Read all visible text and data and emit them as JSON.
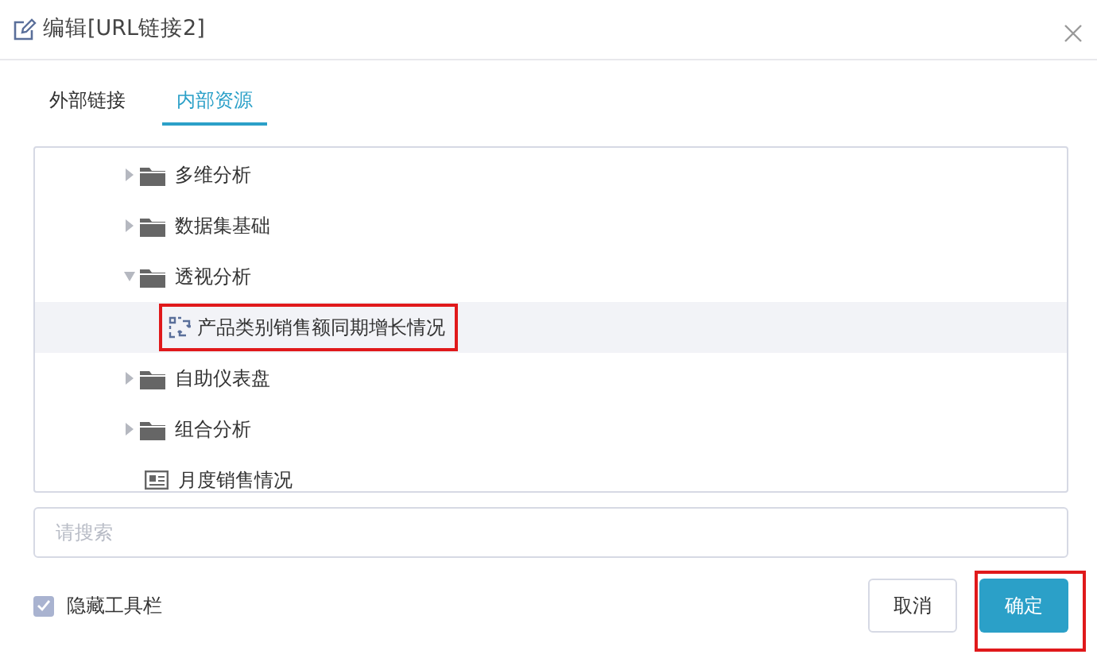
{
  "dialog": {
    "title": "编辑[URL链接2]"
  },
  "tabs": [
    {
      "label": "外部链接",
      "selected": false
    },
    {
      "label": "内部资源",
      "selected": true
    }
  ],
  "tree": [
    {
      "kind": "folder",
      "label": "多维分析",
      "expanded": false
    },
    {
      "kind": "folder",
      "label": "数据集基础",
      "expanded": false
    },
    {
      "kind": "folder",
      "label": "透视分析",
      "expanded": true,
      "children": [
        {
          "kind": "pivot",
          "label": "产品类别销售额同期增长情况",
          "selected": true,
          "highlighted": true
        }
      ]
    },
    {
      "kind": "folder",
      "label": "自助仪表盘",
      "expanded": false
    },
    {
      "kind": "folder",
      "label": "组合分析",
      "expanded": false
    },
    {
      "kind": "report",
      "label": "月度销售情况",
      "selected": false
    }
  ],
  "search": {
    "placeholder": "请搜索"
  },
  "hide_toolbar": {
    "label": "隐藏工具栏",
    "checked": true
  },
  "buttons": [
    {
      "kind": "cancel",
      "label": "取消",
      "highlighted": false
    },
    {
      "kind": "ok",
      "label": "确定",
      "highlighted": true
    }
  ]
}
